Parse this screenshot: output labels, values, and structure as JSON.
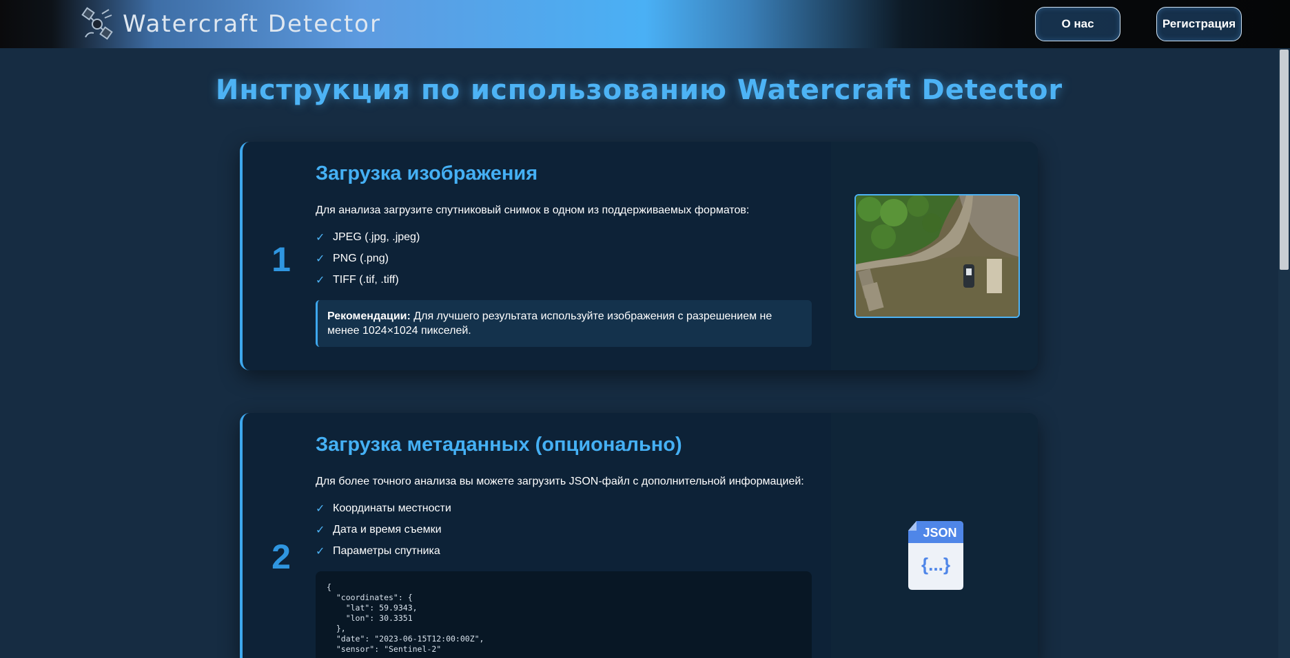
{
  "header": {
    "brand_title": "Watercraft Detector",
    "nav_about": "О нас",
    "nav_register": "Регистрация"
  },
  "page_title": "Инструкция по использованию Watercraft Detector",
  "steps": [
    {
      "number": "1",
      "title": "Загрузка изображения",
      "intro": "Для анализа загрузите спутниковый снимок в одном из поддерживаемых форматов:",
      "items": [
        "JPEG (.jpg, .jpeg)",
        "PNG (.png)",
        "TIFF (.tif, .tiff)"
      ],
      "note_label": "Рекомендации:",
      "note_text": " Для лучшего результата используйте изображения с разрешением не менее 1024×1024 пикселей.",
      "media": "satellite-image"
    },
    {
      "number": "2",
      "title": "Загрузка метаданных (опционально)",
      "intro": "Для более точного анализа вы можете загрузить JSON-файл с дополнительной информацией:",
      "items": [
        "Координаты местности",
        "Дата и время съемки",
        "Параметры спутника"
      ],
      "code": "{\n  \"coordinates\": {\n    \"lat\": 59.9343,\n    \"lon\": 30.3351\n  },\n  \"date\": \"2023-06-15T12:00:00Z\",\n  \"sensor\": \"Sentinel-2\"",
      "media": "json-file-icon",
      "json_badge": "JSON",
      "json_braces": "{...}"
    }
  ],
  "check_symbol": "✓",
  "colors": {
    "accent": "#4db3f5",
    "background": "#162c42",
    "card": "#0d2237"
  }
}
